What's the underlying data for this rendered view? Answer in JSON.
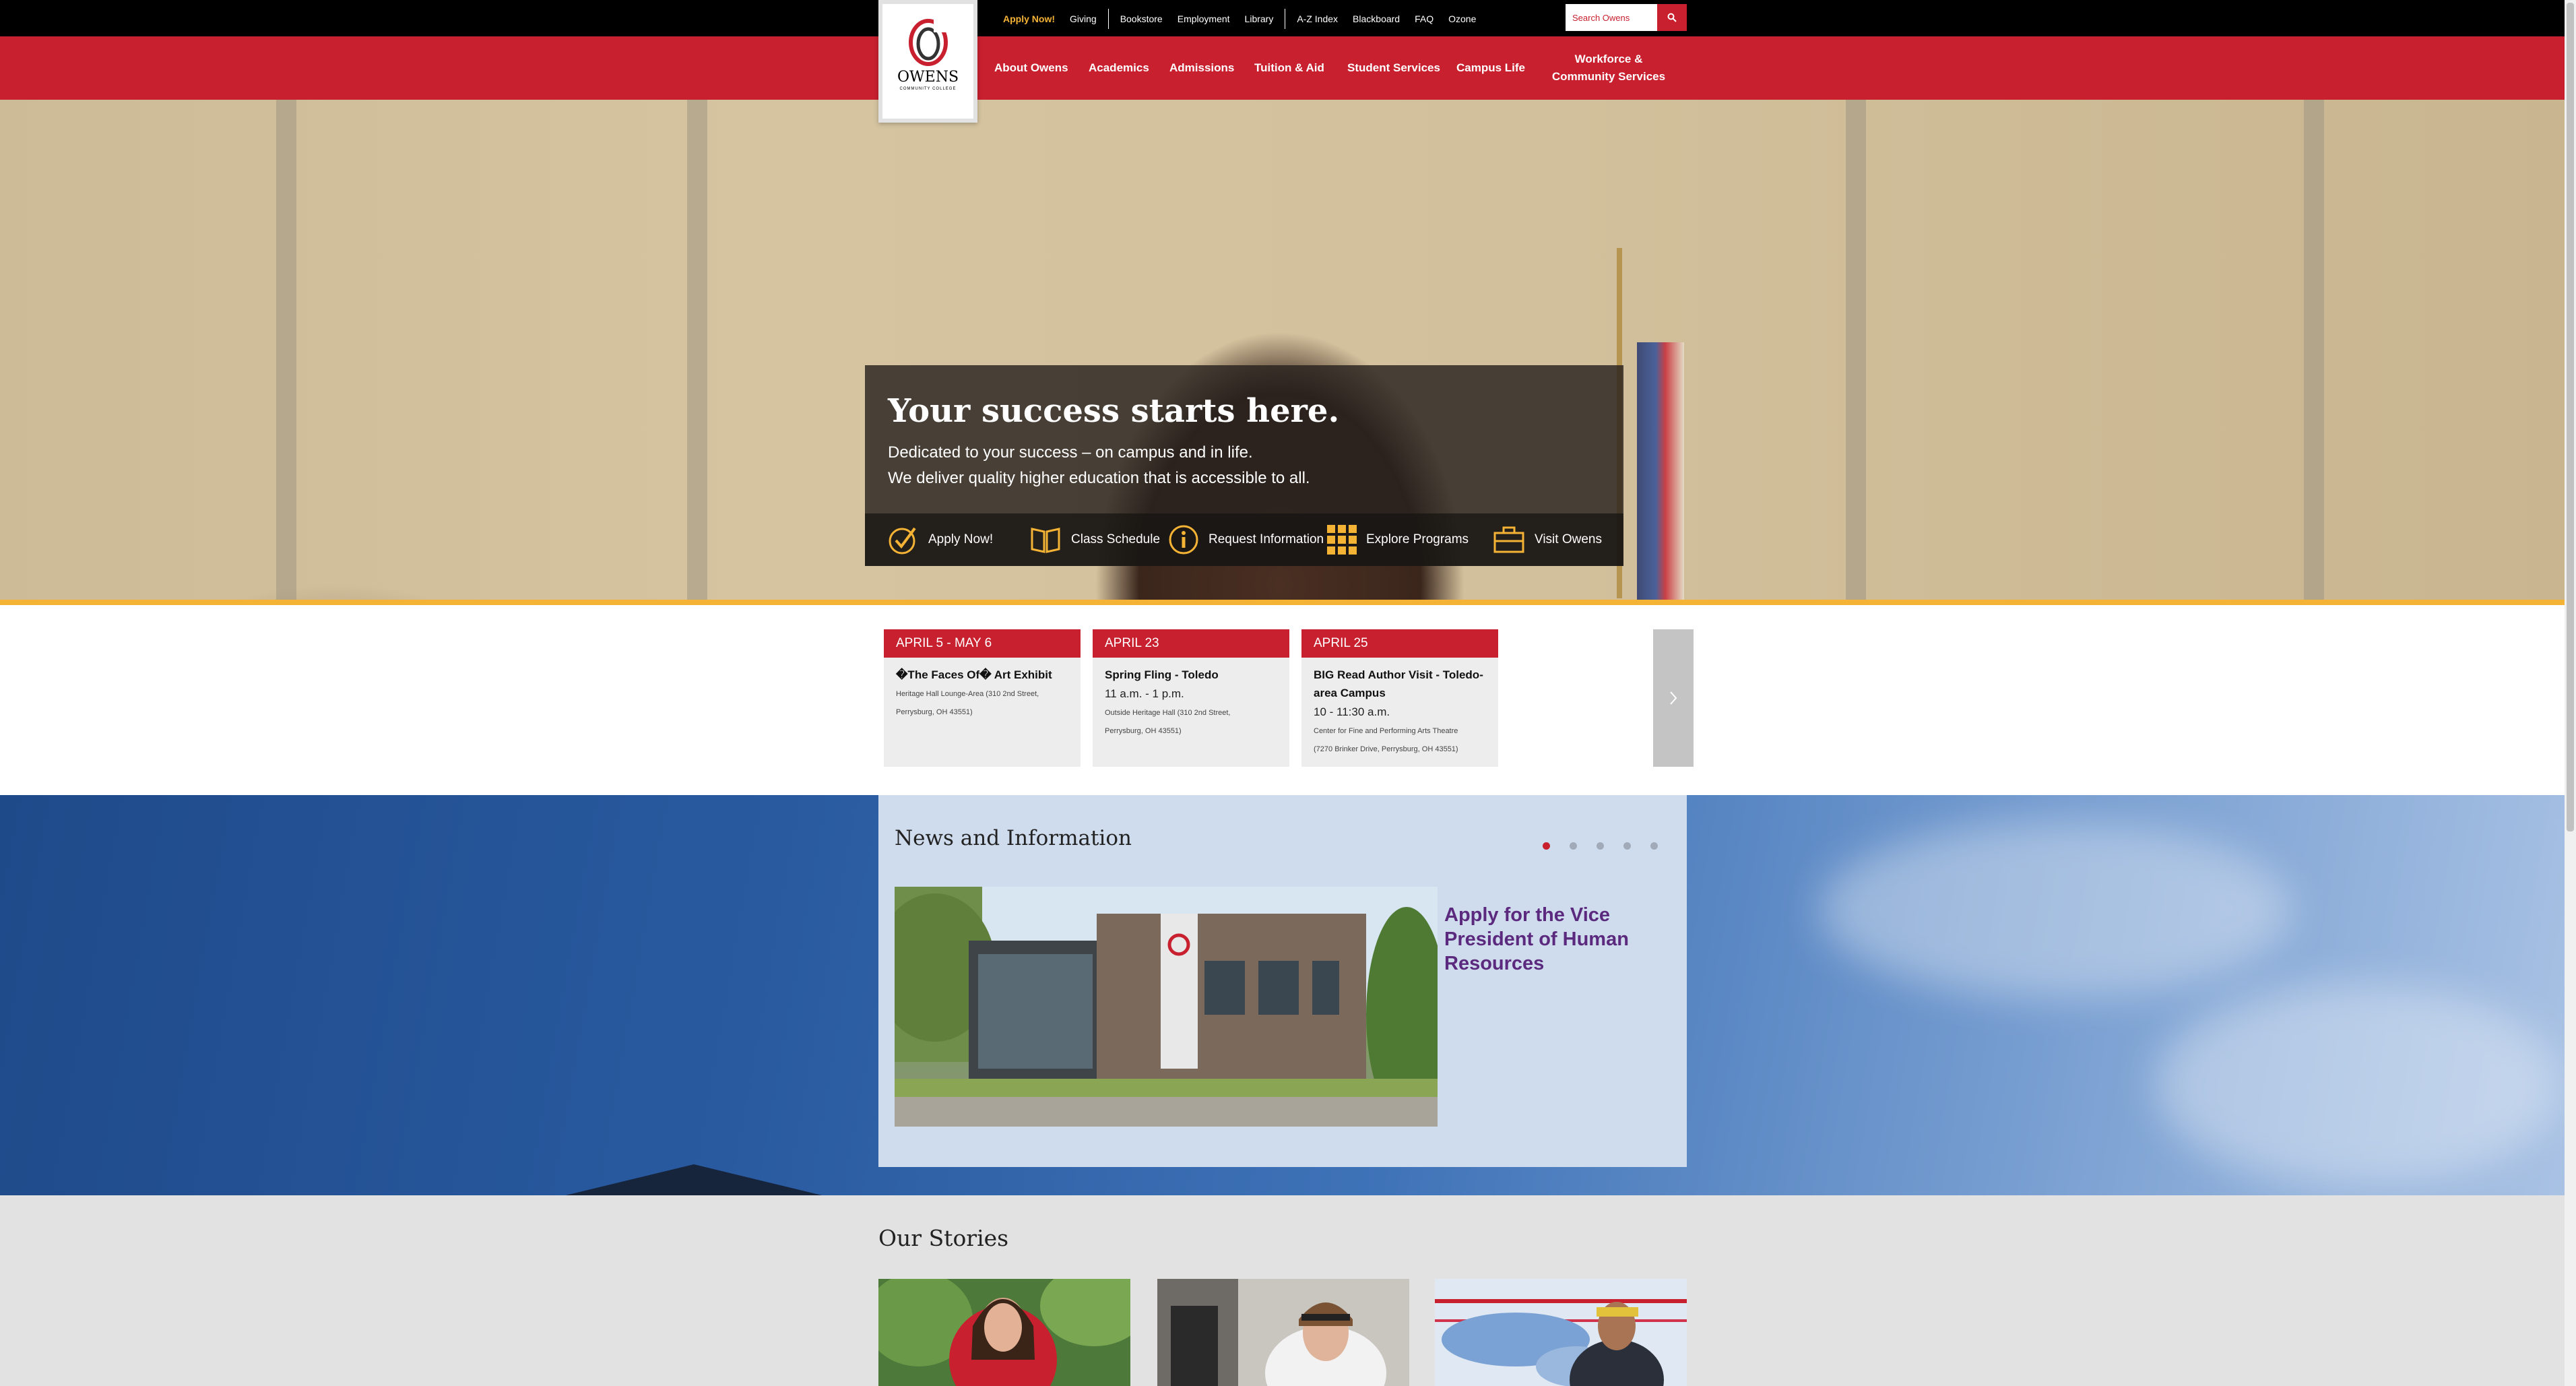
{
  "utility_nav": {
    "apply": "Apply Now!",
    "giving": "Giving",
    "bookstore": "Bookstore",
    "employment": "Employment",
    "library": "Library",
    "az_index": "A-Z Index",
    "blackboard": "Blackboard",
    "faq": "FAQ",
    "ozone": "Ozone"
  },
  "search": {
    "placeholder": "Search Owens"
  },
  "logo": {
    "word": "OWENS",
    "sub": "COMMUNITY COLLEGE"
  },
  "main_nav": {
    "about": "About Owens",
    "academics": "Academics",
    "admissions": "Admissions",
    "tuition": "Tuition & Aid",
    "student_services": "Student Services",
    "campus_life": "Campus Life",
    "workforce_1": "Workforce &",
    "workforce_2": "Community Services"
  },
  "hero": {
    "title": "Your success starts here.",
    "line1": "Dedicated to your success – on campus and in life.",
    "line2": "We deliver quality higher education that is accessible to all.",
    "actions": {
      "apply": "Apply Now!",
      "schedule": "Class Schedule",
      "request": "Request Information",
      "programs": "Explore Programs",
      "visit": "Visit Owens"
    }
  },
  "events": [
    {
      "date": "APRIL 5 - MAY 6",
      "title": "�The Faces Of� Art Exhibit",
      "time": "",
      "location1": "Heritage Hall Lounge-Area (310 2nd Street,",
      "location2": "Perrysburg, OH 43551)"
    },
    {
      "date": "APRIL 23",
      "title": "Spring Fling - Toledo",
      "time": "11 a.m. - 1 p.m.",
      "location1": "Outside Heritage Hall (310 2nd Street,",
      "location2": "Perrysburg, OH 43551)"
    },
    {
      "date": "APRIL 25",
      "title1": "BIG Read Author Visit - Toledo-",
      "title2": "area Campus",
      "time": "10 - 11:30 a.m.",
      "location1": "Center for Fine and Performing Arts Theatre",
      "location2": "(7270 Brinker Drive, Perrysburg, OH 43551)"
    }
  ],
  "news": {
    "heading": "News and Information",
    "slide_count": 5,
    "active_slide": 1,
    "link_line1": "Apply for the Vice",
    "link_line2": "President of Human",
    "link_line3": "Resources"
  },
  "stories": {
    "heading": "Our Stories"
  },
  "colors": {
    "brand_red": "#c8202f",
    "gold": "#f5b335",
    "news_purple": "#5b2a7e"
  }
}
